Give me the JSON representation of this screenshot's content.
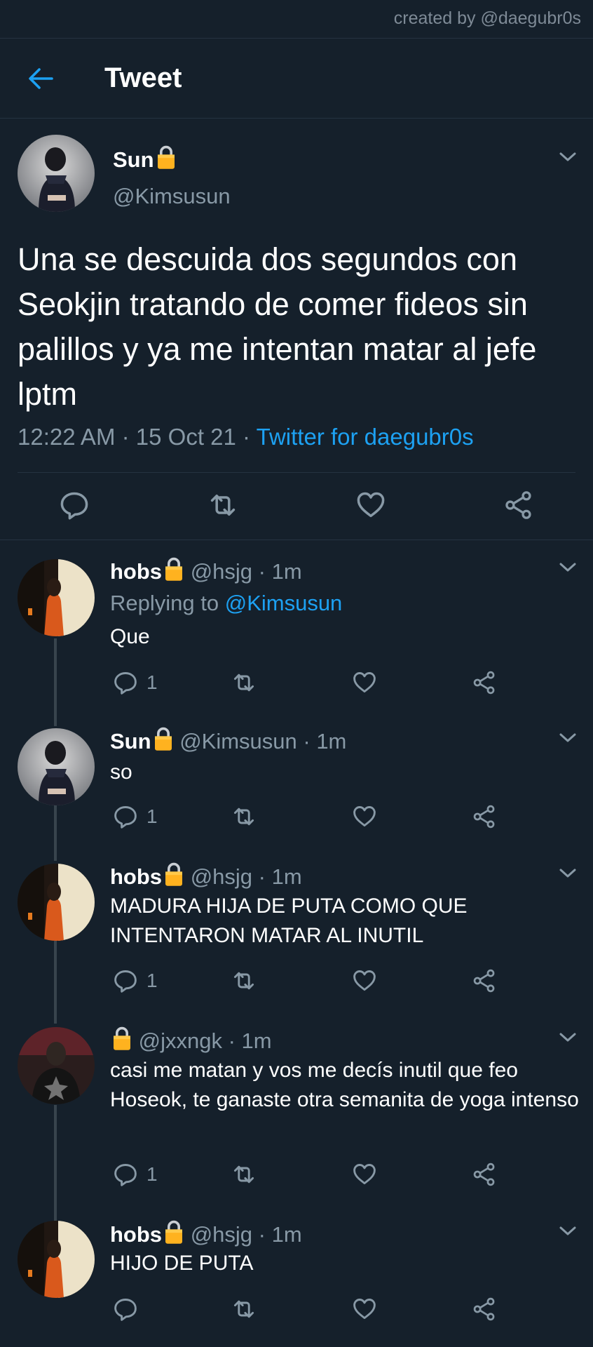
{
  "watermark": "created by @daegubr0s",
  "header": {
    "title": "Tweet",
    "back_icon": "arrow-left-icon"
  },
  "colors": {
    "background": "#15202b",
    "accent": "#1da1f2",
    "muted": "#8899a6",
    "divider": "#253341",
    "lock": "#ffb21f"
  },
  "main_tweet": {
    "name": "Sun",
    "handle": "@Kimsusun",
    "text": "Una se descuida dos segundos con Seokjin tratando de comer fideos sin palillos y ya me intentan matar al jefe lptm",
    "time": "12:22 AM",
    "date": "15 Oct 21",
    "dot": "·",
    "source": "Twitter for daegubr0s"
  },
  "replies": [
    {
      "name": "hobs",
      "handle": "@hsjg · 1m",
      "replying_label": "Replying to ",
      "replying_to": "@Kimsusun",
      "text": "Que",
      "reply_count": "1"
    },
    {
      "name": "Sun",
      "handle": "@Kimsusun · 1m",
      "text": "so",
      "reply_count": "1"
    },
    {
      "name": "hobs",
      "handle": "@hsjg · 1m",
      "text": "MADURA HIJA DE PUTA COMO QUE INTENTARON MATAR AL INUTIL",
      "reply_count": "1"
    },
    {
      "name": "",
      "handle": "@jxxngk · 1m",
      "text": "casi me matan y vos me decís inutil que feo Hoseok, te ganaste otra semanita de yoga intenso",
      "reply_count": "1"
    },
    {
      "name": "hobs",
      "handle": "@hsjg · 1m",
      "text": "HIJO DE PUTA",
      "reply_count": ""
    }
  ]
}
